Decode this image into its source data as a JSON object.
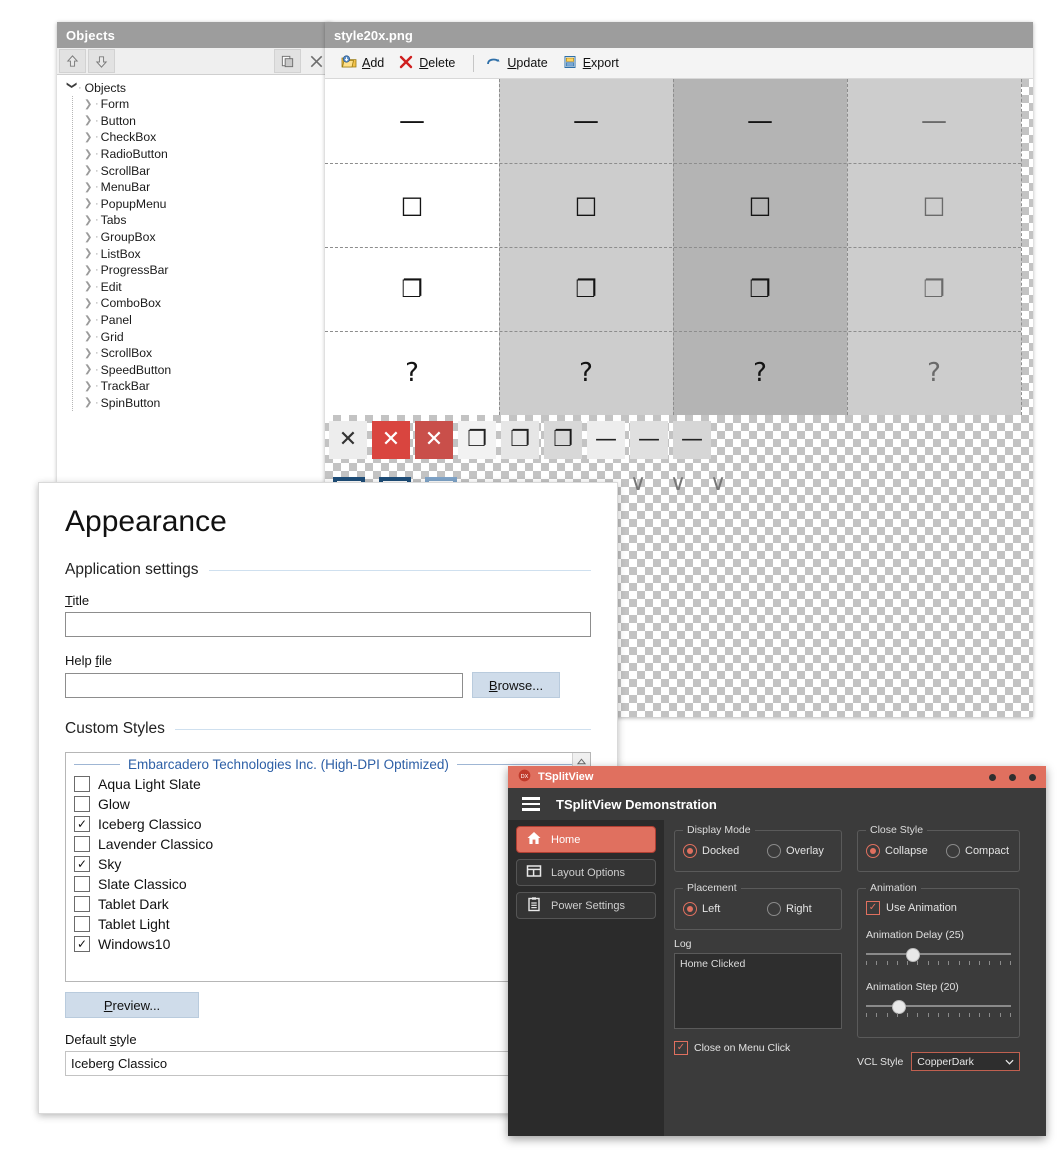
{
  "objects_panel": {
    "header_title": "Objects",
    "toolbar": [
      {
        "name": "move-up-button",
        "icon": "arrow-up-icon"
      },
      {
        "name": "move-down-button",
        "icon": "arrow-down-icon"
      },
      {
        "name": "copy-button",
        "icon": "copy-icon"
      },
      {
        "name": "delete-button",
        "icon": "close-x-icon"
      }
    ],
    "tree_root": "Objects",
    "tree_items": [
      "Form",
      "Button",
      "CheckBox",
      "RadioButton",
      "ScrollBar",
      "MenuBar",
      "PopupMenu",
      "Tabs",
      "GroupBox",
      "ListBox",
      "ProgressBar",
      "Edit",
      "ComboBox",
      "Panel",
      "Grid",
      "ScrollBox",
      "SpeedButton",
      "TrackBar",
      "SpinButton"
    ]
  },
  "style_panel": {
    "header_title": "style20x.png",
    "toolbar": [
      {
        "label_pre": "",
        "accel": "A",
        "label_post": "dd",
        "full": "Add",
        "icon": "add-folder-icon"
      },
      {
        "label_pre": "",
        "accel": "D",
        "label_post": "elete",
        "full": "Delete",
        "icon": "red-x-icon"
      },
      {
        "label_pre": "",
        "accel": "U",
        "label_post": "pdate",
        "full": "Update",
        "icon": "refresh-arrow-icon"
      },
      {
        "label_pre": "",
        "accel": "E",
        "label_post": "xport",
        "full": "Export",
        "icon": "export-icon"
      }
    ],
    "sprite_grid": {
      "rows": [
        {
          "glyph": "—",
          "name": "minimize"
        },
        {
          "glyph": "□",
          "name": "maximize"
        },
        {
          "glyph": "❐",
          "name": "restore"
        },
        {
          "glyph": "?",
          "name": "help"
        }
      ],
      "close_glyph": "✕",
      "col_backgrounds": [
        "#ffffff",
        "#cdcdcd",
        "#b4b4b4",
        "#cdcdcd"
      ],
      "close_col_backgrounds": [
        "#ffffff",
        "#cdcdcd",
        "#d24b4b",
        "#c44b4b"
      ],
      "accent_red": "#d24b4b"
    },
    "small_strip": [
      {
        "glyph": "✕",
        "bg": "#ededed",
        "fg": "#333333"
      },
      {
        "glyph": "✕",
        "bg": "#d9453f",
        "fg": "#ffffff"
      },
      {
        "glyph": "✕",
        "bg": "#c94f4a",
        "fg": "#ffffff"
      },
      {
        "glyph": "❐",
        "bg": "#f2f2f2",
        "fg": "#222222"
      },
      {
        "glyph": "❐",
        "bg": "#e6e6e6",
        "fg": "#222222"
      },
      {
        "glyph": "❐",
        "bg": "#d8d8d8",
        "fg": "#1a1a1a"
      },
      {
        "glyph": "—",
        "bg": "#ededed",
        "fg": "#222222"
      },
      {
        "glyph": "—",
        "bg": "#e0e0e0",
        "fg": "#222222"
      },
      {
        "glyph": "—",
        "bg": "#d6d6d6",
        "fg": "#222222"
      }
    ],
    "misc_sprites": {
      "plus_glyph": "+",
      "minus_glyph": "−",
      "chevron_glyph": "∨",
      "radio_color": "#1f4e79"
    }
  },
  "appearance": {
    "title": "Appearance",
    "app_settings_group": "Application settings",
    "title_field": {
      "label_pre": "",
      "accel": "T",
      "label_post": "itle",
      "label": "Title",
      "value": "",
      "placeholder": ""
    },
    "help_field": {
      "label": "Help file",
      "label_pre": "Help ",
      "accel": "f",
      "label_post": "ile",
      "value": "",
      "placeholder": ""
    },
    "browse_button": {
      "accel": "B",
      "label_post": "rowse...",
      "full": "Browse..."
    },
    "custom_styles_group": "Custom Styles",
    "styles_separator": "Embarcadero Technologies Inc. (High-DPI Optimized)",
    "styles": [
      {
        "label": "Aqua Light Slate",
        "checked": false
      },
      {
        "label": "Glow",
        "checked": false
      },
      {
        "label": "Iceberg Classico",
        "checked": true
      },
      {
        "label": "Lavender Classico",
        "checked": false
      },
      {
        "label": "Sky",
        "checked": true
      },
      {
        "label": "Slate Classico",
        "checked": false
      },
      {
        "label": "Tablet Dark",
        "checked": false
      },
      {
        "label": "Tablet Light",
        "checked": false
      },
      {
        "label": "Windows10",
        "checked": true
      }
    ],
    "preview_button": {
      "accel": "P",
      "label_post": "review...",
      "full": "Preview..."
    },
    "default_style_label": {
      "pre": "Default ",
      "accel": "s",
      "post": "tyle",
      "full": "Default style"
    },
    "default_style_value": "Iceberg Classico",
    "check_mark": "✓"
  },
  "tsplitview": {
    "caption": "TSplitView",
    "app_title": "TSplitView Demonstration",
    "accent_color": "#e0705f",
    "sidebar": [
      {
        "label": "Home",
        "icon": "home-icon",
        "active": true
      },
      {
        "label": "Layout Options",
        "icon": "layout-icon",
        "active": false
      },
      {
        "label": "Power Settings",
        "icon": "clipboard-icon",
        "active": false
      }
    ],
    "display_mode": {
      "caption": "Display Mode",
      "options": [
        {
          "label": "Docked",
          "selected": true
        },
        {
          "label": "Overlay",
          "selected": false
        }
      ]
    },
    "placement": {
      "caption": "Placement",
      "options": [
        {
          "label": "Left",
          "selected": true
        },
        {
          "label": "Right",
          "selected": false
        }
      ]
    },
    "close_style": {
      "caption": "Close Style",
      "options": [
        {
          "label": "Collapse",
          "selected": true
        },
        {
          "label": "Compact",
          "selected": false
        }
      ]
    },
    "animation": {
      "caption": "Animation",
      "use_animation": {
        "label": "Use Animation",
        "checked": true
      },
      "delay": {
        "label": "Animation Delay (25)",
        "value": 25,
        "percent": 32
      },
      "step": {
        "label": "Animation Step (20)",
        "value": 20,
        "percent": 22
      }
    },
    "log": {
      "label": "Log",
      "lines": [
        "Home Clicked"
      ]
    },
    "close_on_menu_click": {
      "label": "Close on Menu Click",
      "checked": true
    },
    "vcl_style": {
      "label": "VCL Style",
      "value": "CopperDark"
    },
    "check_mark": "✓",
    "chevron_down": "⌄"
  }
}
